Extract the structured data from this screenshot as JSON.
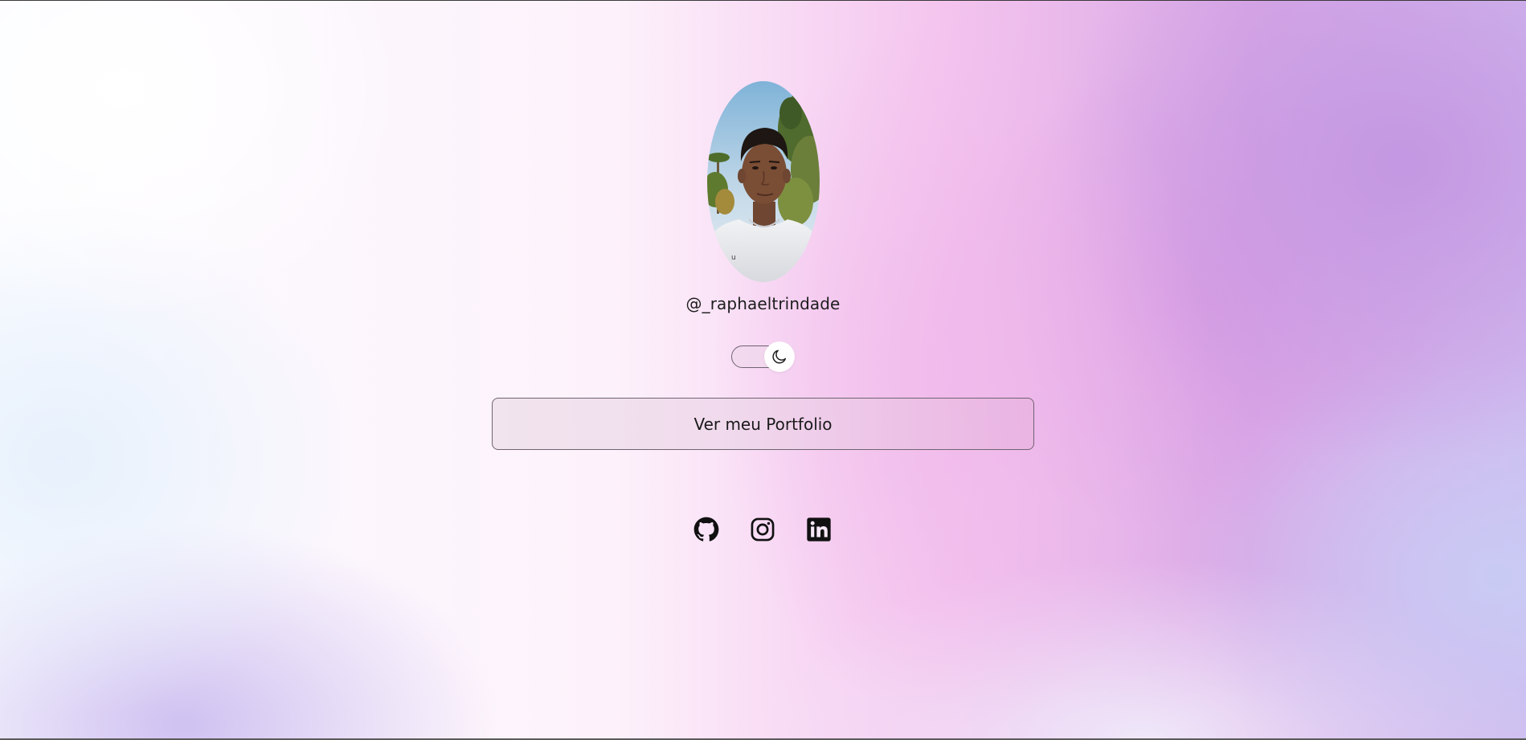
{
  "profile": {
    "image_description_icon": "profile-photo",
    "username": "@_raphaeltrindade"
  },
  "theme_toggle": {
    "icon": "moon-icon",
    "state": "off"
  },
  "portfolio_button": {
    "label": "Ver meu Portfolio"
  },
  "socials": [
    {
      "icon": "github-icon"
    },
    {
      "icon": "instagram-icon"
    },
    {
      "icon": "linkedin-icon"
    }
  ],
  "colors": {
    "text": "#1c1c1c",
    "border": "#6e6570",
    "accent_pink": "#f4c4ee",
    "accent_purple": "#c896e0"
  }
}
